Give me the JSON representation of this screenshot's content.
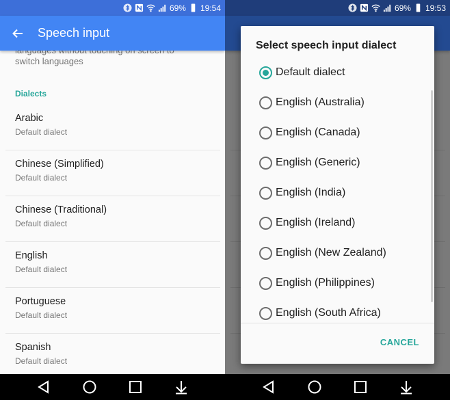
{
  "left": {
    "status": {
      "battery": "69%",
      "time": "19:54"
    },
    "appbar": {
      "title": "Speech input"
    },
    "cut_description": "languages without touching on screen to switch languages",
    "section_header": "Dialects",
    "dialects": [
      {
        "name": "Arabic",
        "value": "Default dialect"
      },
      {
        "name": "Chinese (Simplified)",
        "value": "Default dialect"
      },
      {
        "name": "Chinese (Traditional)",
        "value": "Default dialect"
      },
      {
        "name": "English",
        "value": "Default dialect"
      },
      {
        "name": "Portuguese",
        "value": "Default dialect"
      },
      {
        "name": "Spanish",
        "value": "Default dialect"
      }
    ]
  },
  "right": {
    "status": {
      "battery": "69%",
      "time": "19:53"
    },
    "dialog": {
      "title": "Select speech input dialect",
      "options": [
        "Default dialect",
        "English (Australia)",
        "English (Canada)",
        "English (Generic)",
        "English (India)",
        "English (Ireland)",
        "English (New Zealand)",
        "English (Philippines)",
        "English (South Africa)"
      ],
      "selected_index": 0,
      "cancel_label": "CANCEL"
    }
  },
  "colors": {
    "accent": "#26a69a",
    "appbar": "#4285f4",
    "statusbar": "#3d6fd9"
  },
  "icons": [
    "bluetooth-icon",
    "nfc-icon",
    "wifi-icon",
    "signal-icon",
    "battery-icon",
    "back-arrow-icon",
    "nav-back-icon",
    "nav-home-icon",
    "nav-recents-icon",
    "nav-down-icon"
  ]
}
